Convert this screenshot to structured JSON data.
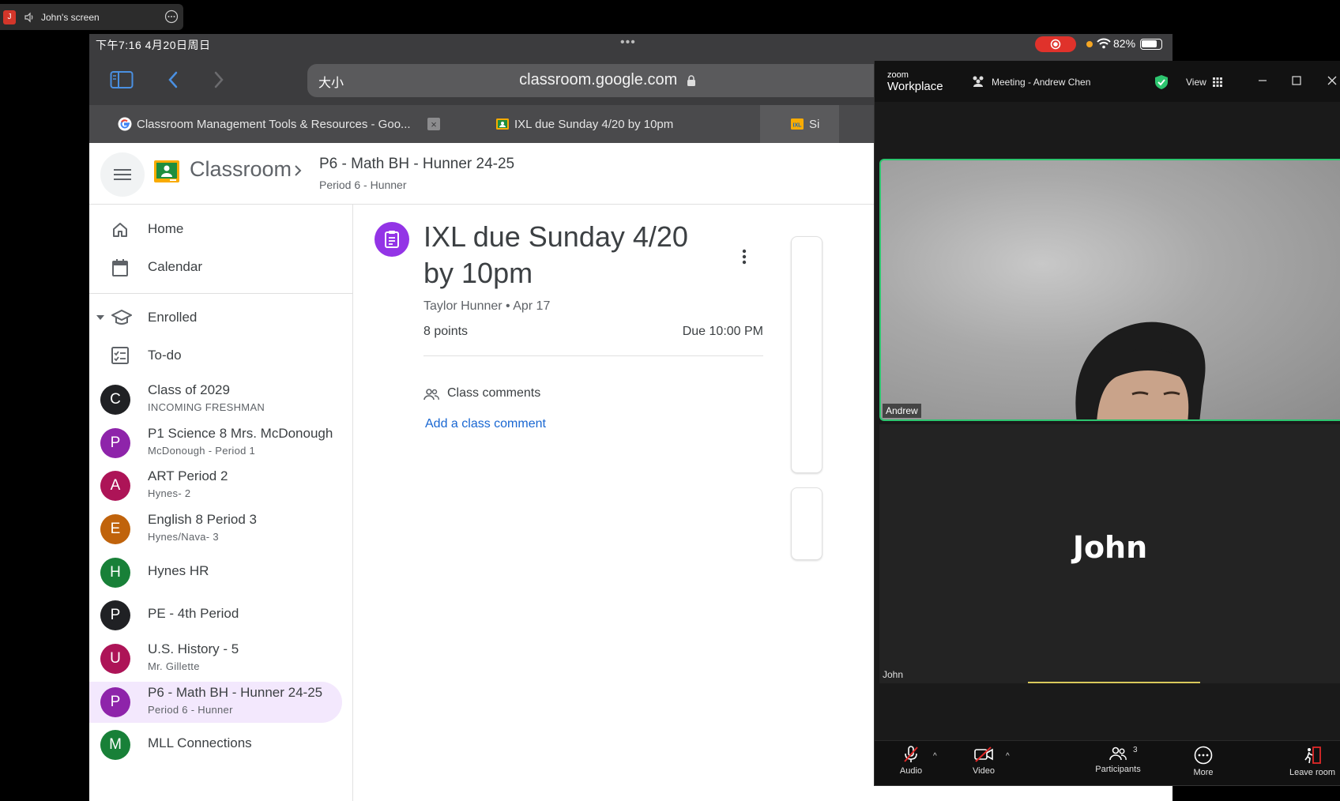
{
  "share_bar": {
    "badge": "J",
    "label": "John's screen"
  },
  "status": {
    "time": "下午7:16   4月20日周日",
    "dots": "•••",
    "battery": "82%",
    "battery_level": 0.82
  },
  "nav": {
    "aa": "大小",
    "url": "classroom.google.com"
  },
  "tabs": [
    {
      "title": "Classroom Management Tools & Resources - Goo..."
    },
    {
      "title": "IXL due Sunday 4/20 by 10pm"
    },
    {
      "title": "Si"
    }
  ],
  "tab_close_glyph": "×",
  "classroom": {
    "app_name": "Classroom",
    "crumb_title": "P6 - Math BH - Hunner 24-25",
    "crumb_sub": "Period 6 - Hunner"
  },
  "sidebar": {
    "home": "Home",
    "calendar": "Calendar",
    "enrolled": "Enrolled",
    "todo": "To-do",
    "courses": [
      {
        "initial": "C",
        "name": "Class of 2029",
        "sub": "INCOMING FRESHMAN",
        "color": "#202124"
      },
      {
        "initial": "P",
        "name": "P1 Science 8 Mrs. McDonough",
        "sub": "McDonough - Period 1",
        "color": "#8e24aa"
      },
      {
        "initial": "A",
        "name": "ART Period 2",
        "sub": "Hynes- 2",
        "color": "#ad1457"
      },
      {
        "initial": "E",
        "name": "English 8 Period 3",
        "sub": "Hynes/Nava- 3",
        "color": "#c0630c"
      },
      {
        "initial": "H",
        "name": "Hynes HR",
        "sub": "",
        "color": "#188038"
      },
      {
        "initial": "P",
        "name": "PE - 4th Period",
        "sub": "",
        "color": "#202124"
      },
      {
        "initial": "U",
        "name": "U.S. History - 5",
        "sub": "Mr. Gillette",
        "color": "#ad1457"
      },
      {
        "initial": "P",
        "name": "P6 - Math BH - Hunner 24-25",
        "sub": "Period 6 - Hunner",
        "color": "#8e24aa"
      },
      {
        "initial": "M",
        "name": "MLL Connections",
        "sub": "",
        "color": "#188038"
      }
    ]
  },
  "assignment": {
    "title": "IXL due Sunday 4/20 by 10pm",
    "meta": "Taylor Hunner • Apr 17",
    "points": "8 points",
    "due": "Due 10:00 PM",
    "comments_label": "Class comments",
    "add_comment": "Add a class comment"
  },
  "zoom": {
    "brand_top": "zoom",
    "brand_bottom": "Workplace",
    "meeting_title": "Meeting - Andrew Chen",
    "view": "View",
    "andrew_label": "Andrew",
    "john_big": "John",
    "john_label": "John",
    "toolbar": {
      "audio": "Audio",
      "video": "Video",
      "participants": "Participants",
      "participants_count": "3",
      "more": "More",
      "leave": "Leave room"
    },
    "accent": "#2dc56f"
  }
}
